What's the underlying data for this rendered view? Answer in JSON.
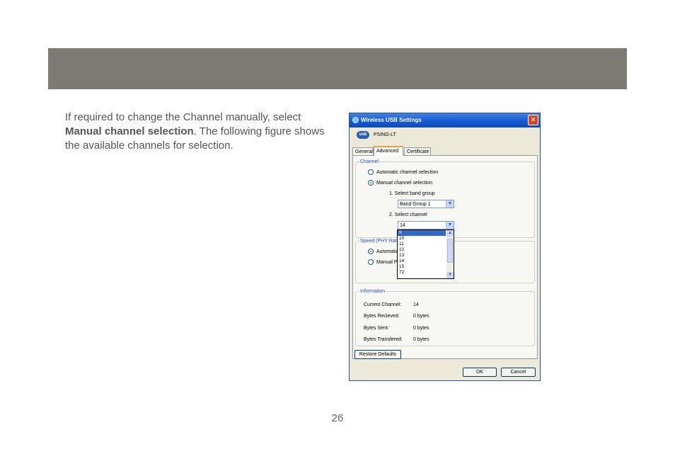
{
  "body": {
    "text_before": "If required to change the Channel manually, select ",
    "bold": "Manual channel selection",
    "text_after": ". The following figure shows the available channels for selection."
  },
  "page_number": "26",
  "dialog": {
    "title": "Wireless USB Settings",
    "close": "×",
    "logo": "usb",
    "device": "PSING-LT",
    "tabs": [
      "General",
      "Advanced",
      "Certificate"
    ],
    "channel": {
      "label": "Channel",
      "auto": "Automatic channel selection",
      "manual": "Manual channel selection",
      "step1": "1. Select band group",
      "band_value": "Band Group 1",
      "step2": "2. Select channel",
      "channel_value": "14",
      "options": [
        "9",
        "10",
        "11",
        "12",
        "13",
        "14",
        "15",
        "72"
      ]
    },
    "speed": {
      "label": "Speed (PHY Rate)",
      "auto": "Automatic (recommended)",
      "manual": "Manual PHY rate"
    },
    "info": {
      "label": "Information",
      "rows": [
        {
          "k": "Current Channel:",
          "v": "14"
        },
        {
          "k": "Bytes Recieved:",
          "v": "0 bytes"
        },
        {
          "k": "Bytes Sent:",
          "v": "0 bytes"
        },
        {
          "k": "Bytes Transfered:",
          "v": "0 bytes"
        }
      ]
    },
    "restore": "Restore Defaults",
    "ok": "OK",
    "cancel": "Cancel",
    "colors": {
      "title_bar": "#1458d0",
      "selection": "#316ac5",
      "group_label": "#2a4ed0"
    }
  }
}
